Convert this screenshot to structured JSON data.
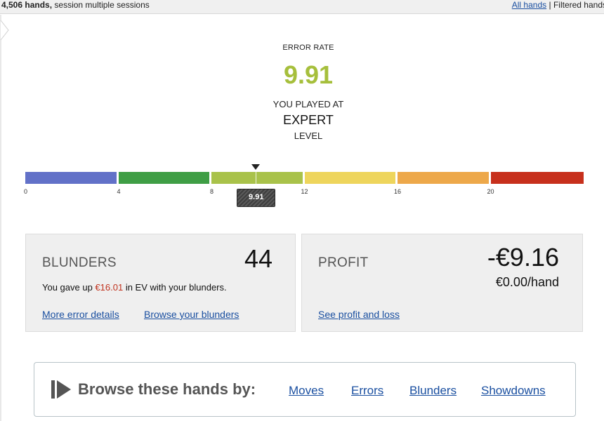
{
  "topbar": {
    "hands_count": "4,506 hands,",
    "session_text": "session multiple sessions",
    "all_hands_link": "All hands",
    "separator": "|",
    "filtered_hands": "Filtered hands"
  },
  "error_rate": {
    "label": "ERROR RATE",
    "value": "9.91",
    "value_numeric": 9.91,
    "played_at": "YOU PLAYED AT",
    "level": "EXPERT",
    "level_word": "LEVEL",
    "value_color": "#a6bf3c"
  },
  "scale": {
    "min": 0,
    "max": 24,
    "segments": [
      {
        "from": 0,
        "to": 4,
        "color": "#6271c8"
      },
      {
        "from": 4,
        "to": 8,
        "color": "#3f9e45"
      },
      {
        "from": 8,
        "to": 12,
        "color": "#a9c24a"
      },
      {
        "from": 12,
        "to": 16,
        "color": "#eed55c"
      },
      {
        "from": 16,
        "to": 20,
        "color": "#eda84a"
      },
      {
        "from": 20,
        "to": 24,
        "color": "#c7301c"
      }
    ],
    "ticks": [
      "0",
      "4",
      "8",
      "12",
      "16",
      "20"
    ],
    "marker_label": "9.91",
    "marker_value": 9.91
  },
  "blunders": {
    "title": "BLUNDERS",
    "count": "44",
    "text_before": "You gave up",
    "amount": "€16.01",
    "text_after": "in EV with your blunders.",
    "more_errors_link": "More error details",
    "browse_blunders_link": "Browse your blunders"
  },
  "profit": {
    "title": "PROFIT",
    "amount": "-€9.16",
    "per_hand": "€0.00/hand",
    "profit_loss_link": "See profit and loss"
  },
  "browse_bar": {
    "icon": "play-step-icon",
    "heading": "Browse these hands by:",
    "links": [
      "Moves",
      "Errors",
      "Blunders",
      "Showdowns"
    ]
  }
}
